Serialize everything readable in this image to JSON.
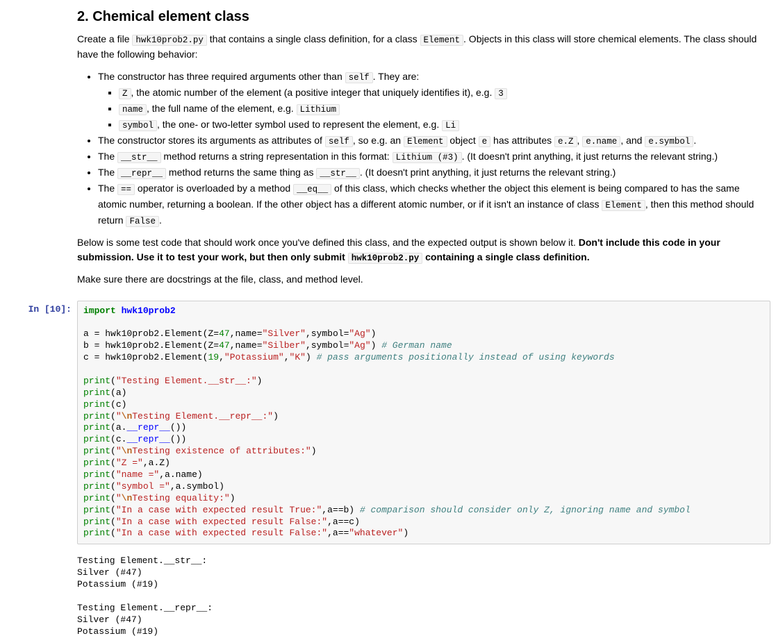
{
  "heading": "2. Chemical element class",
  "intro": {
    "t1": "Create a file ",
    "c1": "hwk10prob2.py",
    "t2": " that contains a single class definition, for a class ",
    "c2": "Element",
    "t3": ". Objects in this class will store chemical elements. The class should have the following behavior:"
  },
  "b1": {
    "t1": "The constructor has three required arguments other than ",
    "c1": "self",
    "t2": ". They are:"
  },
  "b1a": {
    "c1": "Z",
    "t1": ", the atomic number of the element (a positive integer that uniquely identifies it), e.g. ",
    "c2": "3"
  },
  "b1b": {
    "c1": "name",
    "t1": ", the full name of the element, e.g. ",
    "c2": "Lithium"
  },
  "b1c": {
    "c1": "symbol",
    "t1": ", the one- or two-letter symbol used to represent the element, e.g. ",
    "c2": "Li"
  },
  "b2": {
    "t1": "The constructor stores its arguments as attributes of ",
    "c1": "self",
    "t2": ", so e.g. an ",
    "c2": "Element",
    "t3": " object ",
    "c3": "e",
    "t4": " has attributes ",
    "c4": "e.Z",
    "t5": ", ",
    "c5": "e.name",
    "t6": ", and ",
    "c6": "e.symbol",
    "t7": "."
  },
  "b3": {
    "t1": "The ",
    "c1": "__str__",
    "t2": " method returns a string representation in this format: ",
    "c2": "Lithium (#3)",
    "t3": ". (It doesn't print anything, it just returns the relevant string.)"
  },
  "b4": {
    "t1": "The ",
    "c1": "__repr__",
    "t2": " method returns the same thing as ",
    "c2": "__str__",
    "t3": ". (It doesn't print anything, it just returns the relevant string.)"
  },
  "b5": {
    "t1": "The ",
    "c1": "==",
    "t2": " operator is overloaded by a method ",
    "c2": "__eq__",
    "t3": " of this class, which checks whether the object this element is being compared to has the same atomic number, returning a boolean. If the other object has a different atomic number, or if it isn't an instance of class ",
    "c3": "Element",
    "t4": ", then this method should return ",
    "c4": "False",
    "t5": "."
  },
  "note1": {
    "t1": "Below is some test code that should work once you've defined this class, and the expected output is shown below it. ",
    "b1": "Don't include this code in your submission. Use it to test your work, but then only submit ",
    "c1": "hwk10prob2.py",
    "b2": " containing a single class definition."
  },
  "note2": "Make sure there are docstrings at the file, class, and method level.",
  "prompt": "In [10]:",
  "code": {
    "kw_import": "import",
    "mod": "hwk10prob2",
    "l3a": "a ",
    "l3b": "=",
    "l3c": " hwk10prob2",
    "l3d": ".",
    "l3e": "Element(Z",
    "l3f": "=",
    "l3g": "47",
    "l3h": ",name",
    "l3i": "=",
    "l3j": "\"Silver\"",
    "l3k": ",symbol",
    "l3l": "=",
    "l3m": "\"Ag\"",
    "l3n": ")",
    "l4a": "b ",
    "l4b": "=",
    "l4c": " hwk10prob2",
    "l4d": ".",
    "l4e": "Element(Z",
    "l4f": "=",
    "l4g": "47",
    "l4h": ",name",
    "l4i": "=",
    "l4j": "\"Silber\"",
    "l4k": ",symbol",
    "l4l": "=",
    "l4m": "\"Ag\"",
    "l4n": ") ",
    "l4o": "# German name",
    "l5a": "c ",
    "l5b": "=",
    "l5c": " hwk10prob2",
    "l5d": ".",
    "l5e": "Element(",
    "l5f": "19",
    "l5g": ",",
    "l5h": "\"Potassium\"",
    "l5i": ",",
    "l5j": "\"K\"",
    "l5k": ") ",
    "l5l": "# pass arguments positionally instead of using keywords",
    "pr": "print",
    "p1s": "\"Testing Element.__str__:\"",
    "p2": "(a)",
    "p3": "(c)",
    "p4a": "\"",
    "p4b": "\\n",
    "p4c": "Testing Element.__repr__:\"",
    "p5a": "(a",
    "p5b": ".",
    "p5c": "__repr__",
    "p5d": "())",
    "p6a": "(c",
    "p6b": ".",
    "p6c": "__repr__",
    "p6d": "())",
    "p7a": "\"",
    "p7b": "\\n",
    "p7c": "Testing existence of attributes:\"",
    "p8a": "\"Z =\"",
    "p8b": ",a",
    "p8c": ".",
    "p8d": "Z)",
    "p9a": "\"name =\"",
    "p9b": ",a",
    "p9c": ".",
    "p9d": "name)",
    "p10a": "\"symbol =\"",
    "p10b": ",a",
    "p10c": ".",
    "p10d": "symbol)",
    "p11a": "\"",
    "p11b": "\\n",
    "p11c": "Testing equality:\"",
    "p12a": "\"In a case with expected result True:\"",
    "p12b": ",a",
    "p12c": "==",
    "p12d": "b) ",
    "p12e": "# comparison should consider only Z, ignoring name and symbol",
    "p13a": "\"In a case with expected result False:\"",
    "p13b": ",a",
    "p13c": "==",
    "p13d": "c)",
    "p14a": "\"In a case with expected result False:\"",
    "p14b": ",a",
    "p14c": "==",
    "p14d": "\"whatever\"",
    "p14e": ")"
  },
  "output": "Testing Element.__str__:\nSilver (#47)\nPotassium (#19)\n\nTesting Element.__repr__:\nSilver (#47)\nPotassium (#19)"
}
